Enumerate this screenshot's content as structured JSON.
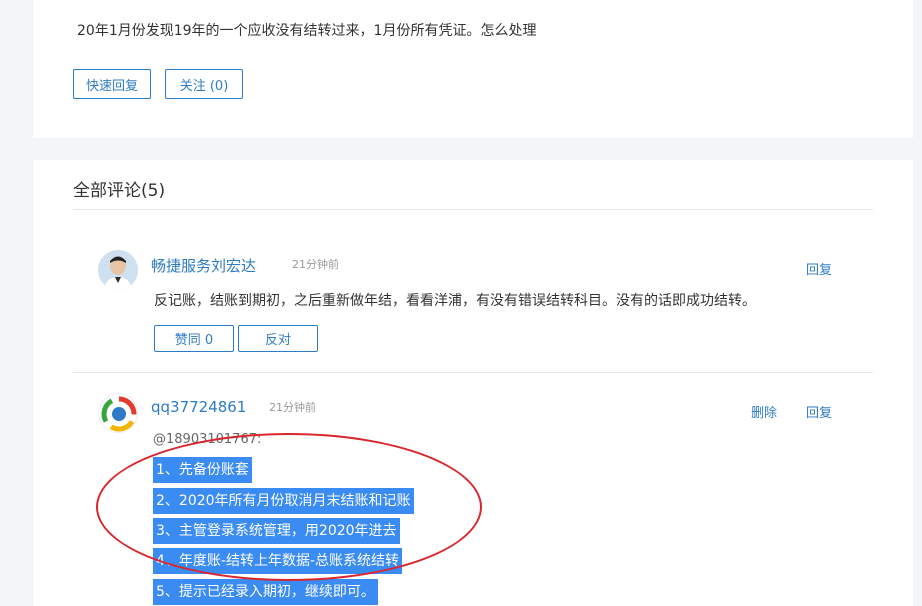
{
  "question": {
    "text": "20年1月份发现19年的一个应收没有结转过来，1月份所有凭证。怎么处理",
    "quick_reply_label": "快速回复",
    "follow_label": "关注 (0)"
  },
  "comments_section": {
    "title": "全部评论(5)"
  },
  "comments": [
    {
      "username": "畅捷服务刘宏达",
      "time": "21分钟前",
      "reply_label": "回复",
      "text": "反记账，结账到期初，之后重新做年结，看看洋浦，有没有错误结转科目。没有的话即成功结转。",
      "agree_label": "赞同 0",
      "oppose_label": "反对"
    },
    {
      "username": "qq37724861",
      "time": "21分钟前",
      "delete_label": "删除",
      "reply_label": "回复",
      "mention": "@18903101767:",
      "lines": [
        "1、先备份账套",
        "2、2020年所有月份取消月末结账和记账",
        "3、主管登录系统管理，用2020年进去",
        "4、年度账-结转上年数据-总账系统结转",
        "5、提示已经录入期初，继续即可。"
      ]
    }
  ],
  "colors": {
    "accent": "#2d7bc7",
    "selection": "#3b8cf2",
    "annotation": "#d9272e"
  }
}
